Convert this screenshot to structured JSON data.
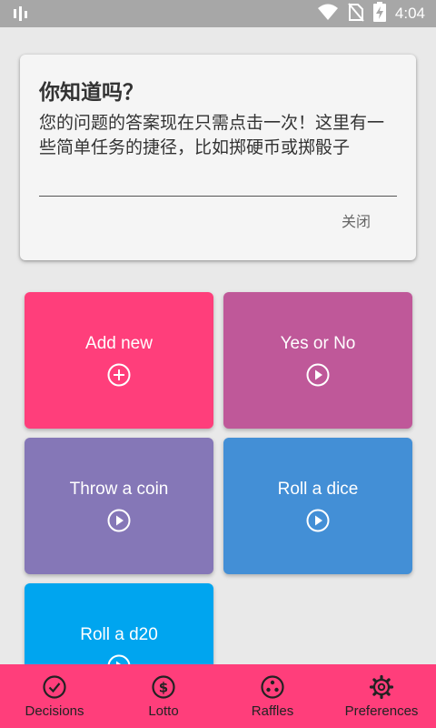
{
  "status_bar": {
    "time": "4:04"
  },
  "info_card": {
    "title": "你知道吗？",
    "body": "您的问题的答案现在只需点击一次！这里有一些简单任务的捷径，比如掷硬币或掷骰子",
    "close_label": "关闭"
  },
  "tiles": [
    {
      "label": "Add new",
      "icon": "plus-circle-icon",
      "color": "#ff3e7b"
    },
    {
      "label": "Yes or No",
      "icon": "play-circle-icon",
      "color": "#bf5899"
    },
    {
      "label": "Throw a coin",
      "icon": "play-circle-icon",
      "color": "#8577b7"
    },
    {
      "label": "Roll a dice",
      "icon": "play-circle-icon",
      "color": "#438fd6"
    },
    {
      "label": "Roll a d20",
      "icon": "play-circle-icon",
      "color": "#00a5ef"
    }
  ],
  "bottom_nav": {
    "color": "#ff3e7b",
    "items": [
      {
        "label": "Decisions",
        "icon": "check-circle-icon"
      },
      {
        "label": "Lotto",
        "icon": "dollar-circle-icon"
      },
      {
        "label": "Raffles",
        "icon": "dice-circle-icon"
      },
      {
        "label": "Preferences",
        "icon": "gear-icon"
      }
    ]
  }
}
